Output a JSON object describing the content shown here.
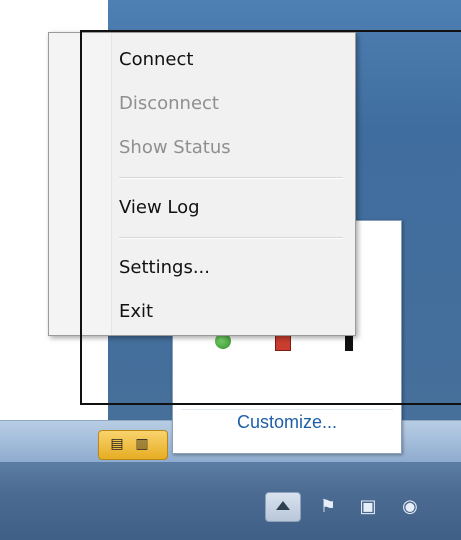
{
  "context_menu": {
    "items": [
      {
        "label": "Connect",
        "enabled": true
      },
      {
        "label": "Disconnect",
        "enabled": false
      },
      {
        "label": "Show Status",
        "enabled": false
      },
      {
        "label": "View Log",
        "enabled": true
      },
      {
        "label": "Settings...",
        "enabled": true
      },
      {
        "label": "Exit",
        "enabled": true
      }
    ]
  },
  "tray_popup": {
    "customize_label": "Customize..."
  },
  "icons": {
    "quick_launch": [
      "document-icon",
      "book-icon"
    ],
    "tray": [
      "flag-icon",
      "network-icon",
      "volume-icon"
    ],
    "overflow": [
      "green-status-icon",
      "red-status-icon",
      "black-status-icon"
    ]
  }
}
